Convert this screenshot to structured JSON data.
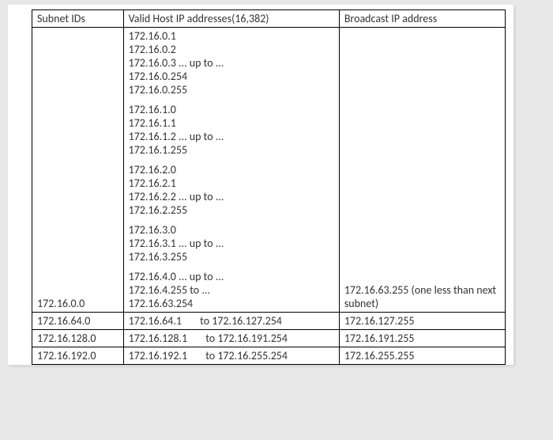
{
  "headers": {
    "subnet": "Subnet IDs",
    "valid": "Valid Host IP addresses(16,382)",
    "broadcast": "Broadcast IP address"
  },
  "row0": {
    "subnet": "172.16.0.0",
    "blocks": [
      {
        "lines": [
          "172.16.0.1",
          "172.16.0.2",
          "172.16.0.3  ... up to ...",
          "172.16.0.254",
          "172.16.0.255"
        ]
      },
      {
        "lines": [
          "172.16.1.0",
          "172.16.1.1",
          "172.16.1.2  ... up to ...",
          "172.16.1.255"
        ]
      },
      {
        "lines": [
          "172.16.2.0",
          "172.16.2.1",
          "172.16.2.2  ... up to ...",
          "172.16.2.255"
        ]
      },
      {
        "lines": [
          "172.16.3.0",
          "172.16.3.1  ... up to ...",
          "172.16.3.255"
        ]
      },
      {
        "lines": [
          "172.16.4.0  ... up to ...",
          "172.16.4.255 to ...",
          "172.16.63.254"
        ]
      }
    ],
    "broadcast": "172.16.63.255 (one less than next subnet)"
  },
  "rows": [
    {
      "subnet": "172.16.64.0",
      "from": "172.16.64.1",
      "to": "to 172.16.127.254",
      "broadcast": "172.16.127.255"
    },
    {
      "subnet": "172.16.128.0",
      "from": "172.16.128.1",
      "to": "to 172.16.191.254",
      "broadcast": "172.16.191.255"
    },
    {
      "subnet": "172.16.192.0",
      "from": "172.16.192.1",
      "to": "to 172.16.255.254",
      "broadcast": "172.16.255.255"
    }
  ]
}
